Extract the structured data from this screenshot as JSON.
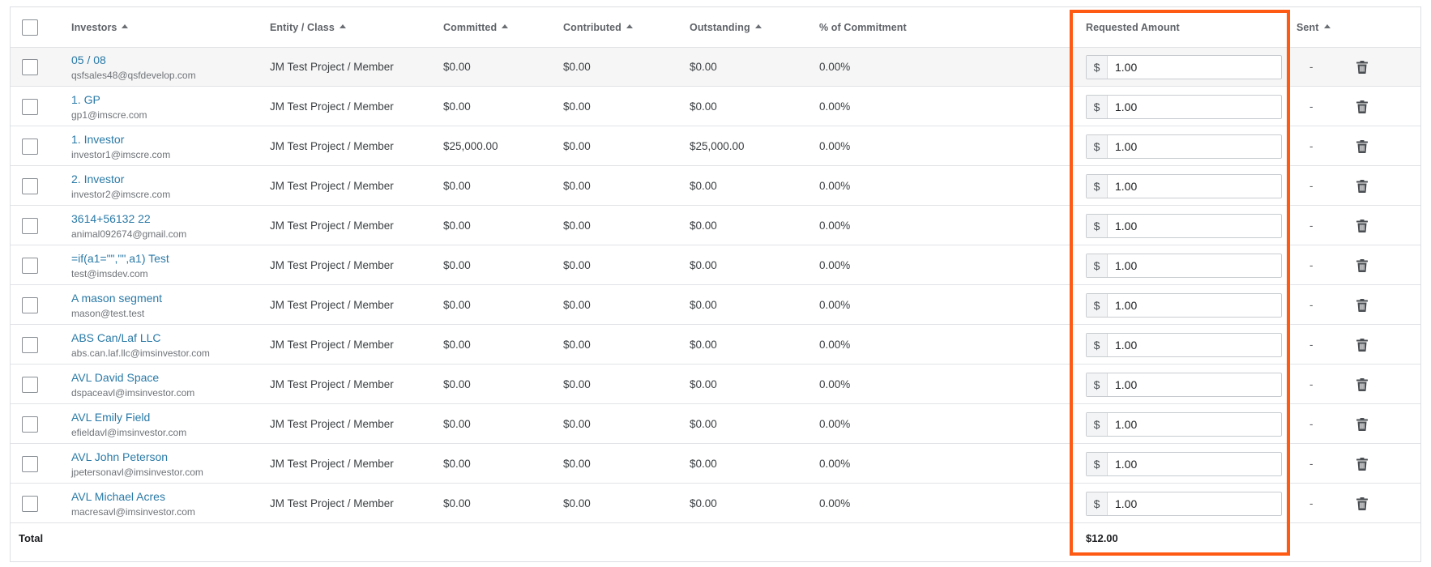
{
  "table": {
    "headers": {
      "investors": "Investors",
      "entity_class": "Entity / Class",
      "committed": "Committed",
      "contributed": "Contributed",
      "outstanding": "Outstanding",
      "pct_commitment": "% of Commitment",
      "requested_amount": "Requested Amount",
      "sent": "Sent"
    },
    "currency_symbol": "$",
    "rows": [
      {
        "name": "05 / 08",
        "email": "qsfsales48@qsfdevelop.com",
        "entity": "JM Test Project / Member",
        "committed": "$0.00",
        "contributed": "$0.00",
        "outstanding": "$0.00",
        "pct": "0.00%",
        "requested": "1.00",
        "sent": "-"
      },
      {
        "name": "1. GP",
        "email": "gp1@imscre.com",
        "entity": "JM Test Project / Member",
        "committed": "$0.00",
        "contributed": "$0.00",
        "outstanding": "$0.00",
        "pct": "0.00%",
        "requested": "1.00",
        "sent": "-"
      },
      {
        "name": "1. Investor",
        "email": "investor1@imscre.com",
        "entity": "JM Test Project / Member",
        "committed": "$25,000.00",
        "contributed": "$0.00",
        "outstanding": "$25,000.00",
        "pct": "0.00%",
        "requested": "1.00",
        "sent": "-"
      },
      {
        "name": "2. Investor",
        "email": "investor2@imscre.com",
        "entity": "JM Test Project / Member",
        "committed": "$0.00",
        "contributed": "$0.00",
        "outstanding": "$0.00",
        "pct": "0.00%",
        "requested": "1.00",
        "sent": "-"
      },
      {
        "name": "3614+56132 22",
        "email": "animal092674@gmail.com",
        "entity": "JM Test Project / Member",
        "committed": "$0.00",
        "contributed": "$0.00",
        "outstanding": "$0.00",
        "pct": "0.00%",
        "requested": "1.00",
        "sent": "-"
      },
      {
        "name": "=if(a1=\"\",\"\",a1) Test",
        "email": "test@imsdev.com",
        "entity": "JM Test Project / Member",
        "committed": "$0.00",
        "contributed": "$0.00",
        "outstanding": "$0.00",
        "pct": "0.00%",
        "requested": "1.00",
        "sent": "-"
      },
      {
        "name": "A mason segment",
        "email": "mason@test.test",
        "entity": "JM Test Project / Member",
        "committed": "$0.00",
        "contributed": "$0.00",
        "outstanding": "$0.00",
        "pct": "0.00%",
        "requested": "1.00",
        "sent": "-"
      },
      {
        "name": "ABS Can/Laf LLC",
        "email": "abs.can.laf.llc@imsinvestor.com",
        "entity": "JM Test Project / Member",
        "committed": "$0.00",
        "contributed": "$0.00",
        "outstanding": "$0.00",
        "pct": "0.00%",
        "requested": "1.00",
        "sent": "-"
      },
      {
        "name": "AVL David Space",
        "email": "dspaceavl@imsinvestor.com",
        "entity": "JM Test Project / Member",
        "committed": "$0.00",
        "contributed": "$0.00",
        "outstanding": "$0.00",
        "pct": "0.00%",
        "requested": "1.00",
        "sent": "-"
      },
      {
        "name": "AVL Emily Field",
        "email": "efieldavl@imsinvestor.com",
        "entity": "JM Test Project / Member",
        "committed": "$0.00",
        "contributed": "$0.00",
        "outstanding": "$0.00",
        "pct": "0.00%",
        "requested": "1.00",
        "sent": "-"
      },
      {
        "name": "AVL John Peterson",
        "email": "jpetersonavl@imsinvestor.com",
        "entity": "JM Test Project / Member",
        "committed": "$0.00",
        "contributed": "$0.00",
        "outstanding": "$0.00",
        "pct": "0.00%",
        "requested": "1.00",
        "sent": "-"
      },
      {
        "name": "AVL Michael Acres",
        "email": "macresavl@imsinvestor.com",
        "entity": "JM Test Project / Member",
        "committed": "$0.00",
        "contributed": "$0.00",
        "outstanding": "$0.00",
        "pct": "0.00%",
        "requested": "1.00",
        "sent": "-"
      }
    ],
    "total": {
      "label": "Total",
      "requested_total": "$12.00"
    }
  },
  "colors": {
    "link": "#2a7aa7",
    "highlight_border": "#ff5a14",
    "first_row_bg": "#f6f6f6"
  },
  "icons": {
    "row_delete": "trash-icon",
    "sort": "sort-up-icon"
  }
}
